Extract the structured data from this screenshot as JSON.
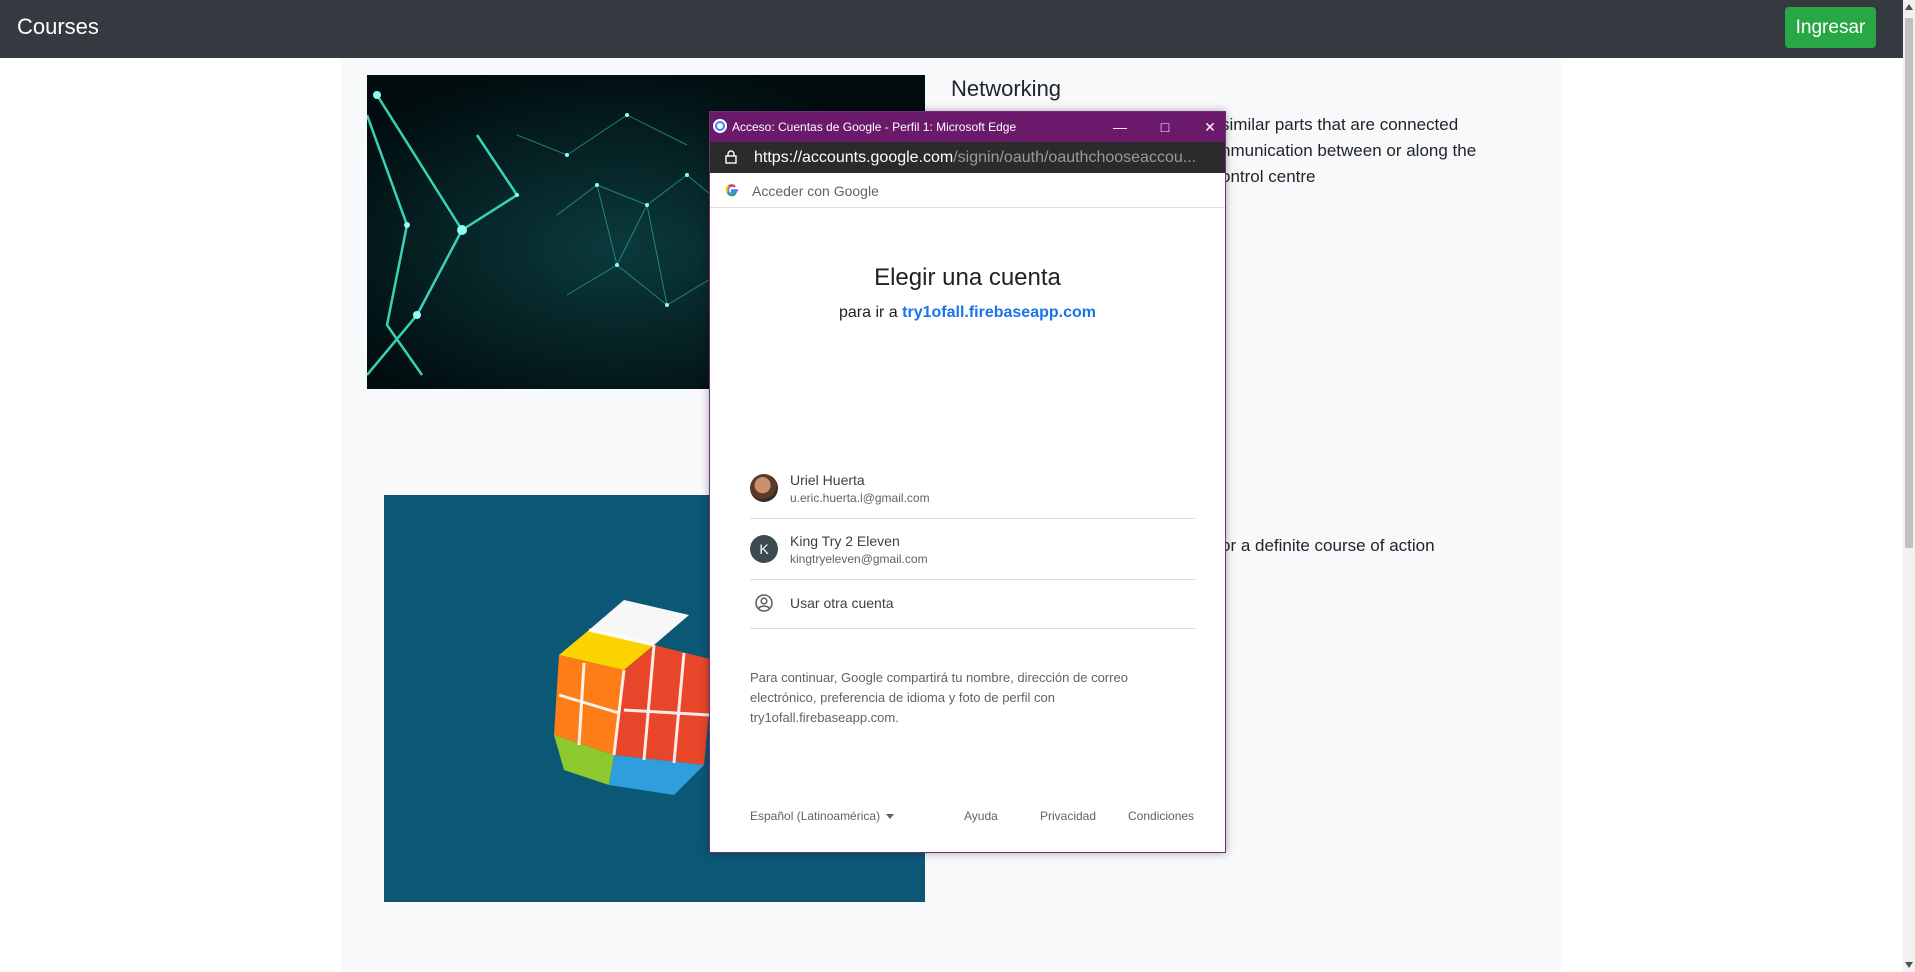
{
  "navbar": {
    "brand": "Courses",
    "login_label": "Ingresar"
  },
  "courses": [
    {
      "title": "Networking",
      "text_line1": "similar parts that are connected",
      "text_line2": "nmunication between or along the",
      "text_line3": "ontrol centre"
    },
    {
      "text_line1": "or a definite course of action"
    }
  ],
  "popup": {
    "window_title": "Acceso: Cuentas de Google - Perfil 1: Microsoft Edge",
    "url_scheme": "https://",
    "url_host": "accounts.google.com",
    "url_rest": "/signin/oauth/oauthchooseaccou...",
    "header_text": "Acceder con Google",
    "title": "Elegir una cuenta",
    "subtitle_prefix": "para ir a ",
    "subtitle_link": "try1ofall.firebaseapp.com",
    "accounts": [
      {
        "name": "Uriel Huerta",
        "email": "u.eric.huerta.l@gmail.com",
        "avatar": "photo"
      },
      {
        "name": "King Try 2 Eleven",
        "email": "kingtryeleven@gmail.com",
        "avatar_letter": "K"
      }
    ],
    "other_account": "Usar otra cuenta",
    "disclaimer": "Para continuar, Google compartirá tu nombre, dirección de correo electrónico, preferencia de idioma y foto de perfil con try1ofall.firebaseapp.com.",
    "footer": {
      "language": "Español (Latinoamérica)",
      "help": "Ayuda",
      "privacy": "Privacidad",
      "terms": "Condiciones"
    }
  },
  "colors": {
    "navbar": "#343a40",
    "login_button": "#28a745",
    "popup_titlebar": "#6b1a6b",
    "link": "#1a73e8"
  }
}
